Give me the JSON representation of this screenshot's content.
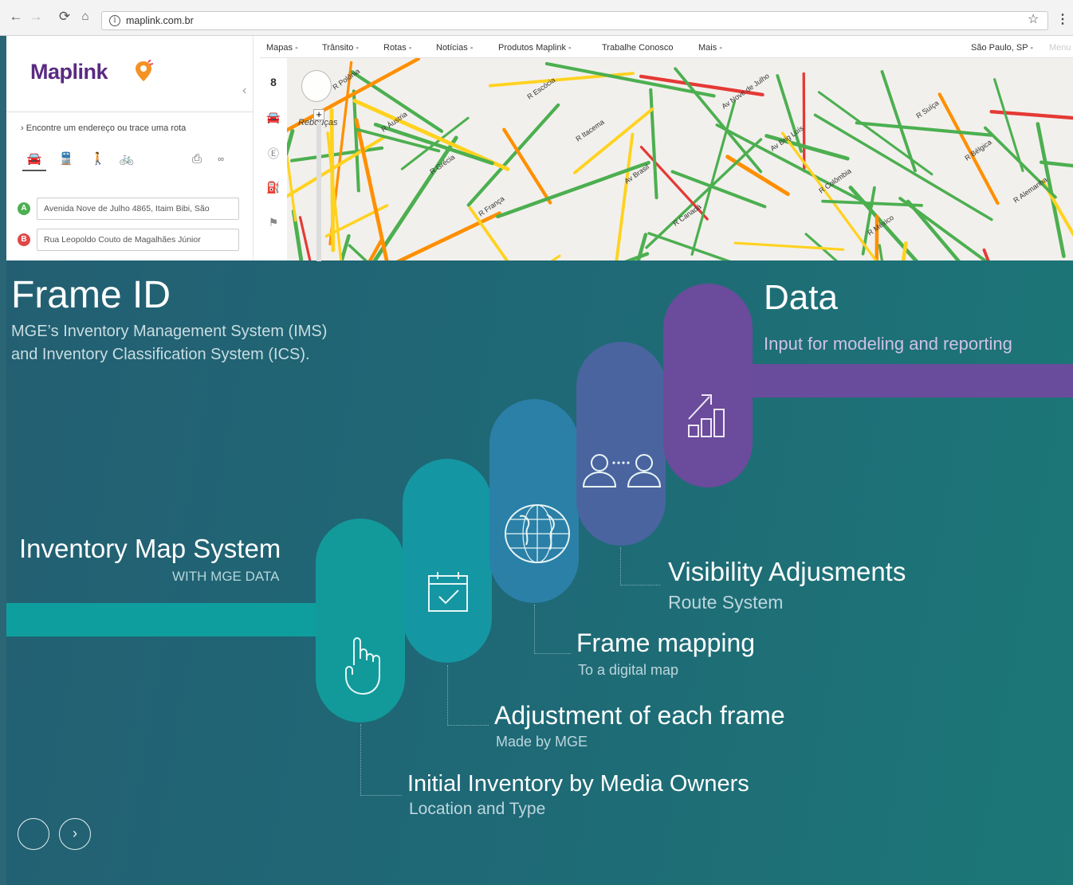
{
  "browser": {
    "url": "maplink.com.br",
    "back_icon": "arrow-left-icon",
    "forward_icon": "arrow-right-icon",
    "reload_icon": "reload-icon",
    "home_icon": "home-icon"
  },
  "maplink": {
    "logo_text": "Maplink",
    "nav": [
      "Mapas -",
      "Trânsito -",
      "Rotas -",
      "Notícias -",
      "Produtos Maplink -",
      "Trabalhe Conosco",
      "Mais -"
    ],
    "city": "São Paulo, SP -",
    "menu": "Menu",
    "find_prompt": "Encontre um endereço ou trace uma rota",
    "address_a": "Avenida Nove de Julho 4865, Itaim Bibi, São",
    "address_b": "Rua Leopoldo Couto de Magalhães Júnior",
    "pin_a": "A",
    "pin_b": "B",
    "map_label": "Rebouças",
    "street_labels": [
      "R Polônia",
      "R Áustria",
      "R Grécia",
      "R França",
      "R Escócia",
      "R Itacema",
      "Av Brasil",
      "R Canadá",
      "Av Nove de Julho",
      "Av Brig Luís",
      "R Colômbia",
      "R México",
      "R Suíça",
      "R Bélgica",
      "R Alemanha"
    ]
  },
  "slide": {
    "title": "Frame ID",
    "subtitle_line1": "MGE’s Inventory Management System (IMS)",
    "subtitle_line2": "and Inventory Classification System (ICS).",
    "left_title": "Inventory Map System",
    "left_sub": "WITH MGE DATA",
    "data_title": "Data",
    "data_sub": "Input for modeling and reporting",
    "steps": [
      {
        "title": "Initial Inventory by Media Owners",
        "sub": "Location and Type"
      },
      {
        "title": "Adjustment of each frame",
        "sub": "Made by MGE"
      },
      {
        "title": "Frame mapping",
        "sub": "To a digital map"
      },
      {
        "title": "Visibility Adjusments",
        "sub": "Route System"
      }
    ],
    "colors": {
      "teal": "#169a9a",
      "cyan": "#1797a4",
      "blue": "#2b7fa6",
      "slate": "#4a63a0",
      "purple": "#6a4c9c"
    }
  }
}
